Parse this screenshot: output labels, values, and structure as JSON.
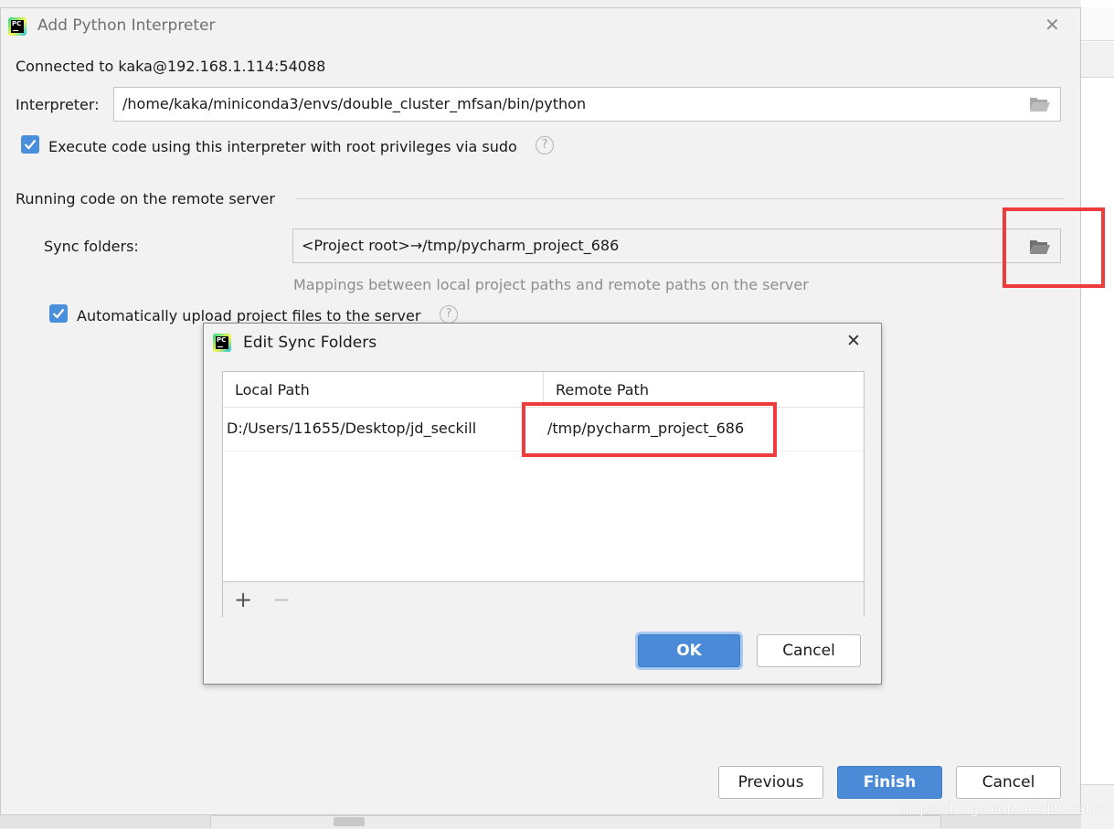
{
  "main_dialog": {
    "title": "Add Python Interpreter",
    "connection": "Connected to kaka@192.168.1.114:54088",
    "interpreter_label": "Interpreter:",
    "interpreter_path": "/home/kaka/miniconda3/envs/double_cluster_mfsan/bin/python",
    "sudo_checkbox_label": "Execute code using this interpreter with root privileges via sudo",
    "sudo_checked": true,
    "section_title": "Running code on the remote server",
    "sync_folders_label": "Sync folders:",
    "sync_folders_value": "<Project root>→/tmp/pycharm_project_686",
    "sync_hint": "Mappings between local project paths and remote paths on the server",
    "auto_upload_label": "Automatically upload project files to the server",
    "auto_upload_checked": true,
    "buttons": {
      "previous": "Previous",
      "finish": "Finish",
      "cancel": "Cancel"
    }
  },
  "sync_dialog": {
    "title": "Edit Sync Folders",
    "columns": [
      "Local Path",
      "Remote Path"
    ],
    "rows": [
      {
        "local": "D:/Users/11655/Desktop/jd_seckill",
        "remote": "/tmp/pycharm_project_686"
      }
    ],
    "toolbar": {
      "add": "+",
      "remove": "−"
    },
    "buttons": {
      "ok": "OK",
      "cancel": "Cancel"
    }
  },
  "watermark": "https://blog.csdn.net/lzhHaHaHa",
  "icons": [
    "pycharm-app-icon",
    "close-icon",
    "folder-open-icon",
    "checkbox-checked-icon",
    "help-icon",
    "add-icon",
    "remove-icon"
  ],
  "colors": {
    "accent": "#4a8ad6",
    "highlight": "#ee3b3b"
  }
}
